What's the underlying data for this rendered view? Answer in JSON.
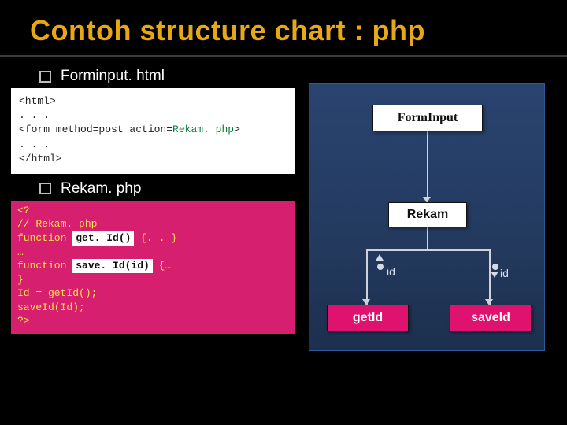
{
  "title": "Contoh structure chart : php",
  "bullets": {
    "forminput": "Forminput. html",
    "rekam": "Rekam. php"
  },
  "code_html": {
    "l1": "<html>",
    "l2": ". . .",
    "l3a": "<form method=post action=",
    "l3b": "Rekam. php",
    "l3c": ">",
    "l4": ". . .",
    "l5": "</html>"
  },
  "code_php": {
    "l1": "<?",
    "l2": "// Rekam. php",
    "l3a": "function ",
    "l3b": "get. Id()",
    "l3c": " {. . }",
    "l4": "…",
    "l5a": "function ",
    "l5b": "save. Id(id)",
    "l5c": " {…",
    "l6": "}",
    "l7": "Id = getId();",
    "l8": "saveId(Id);",
    "l9": "?>"
  },
  "chart": {
    "forminput": "FormInput",
    "rekam": "Rekam",
    "getid": "getId",
    "saveid": "saveId",
    "label_id_left": "id",
    "label_id_right": "id"
  }
}
